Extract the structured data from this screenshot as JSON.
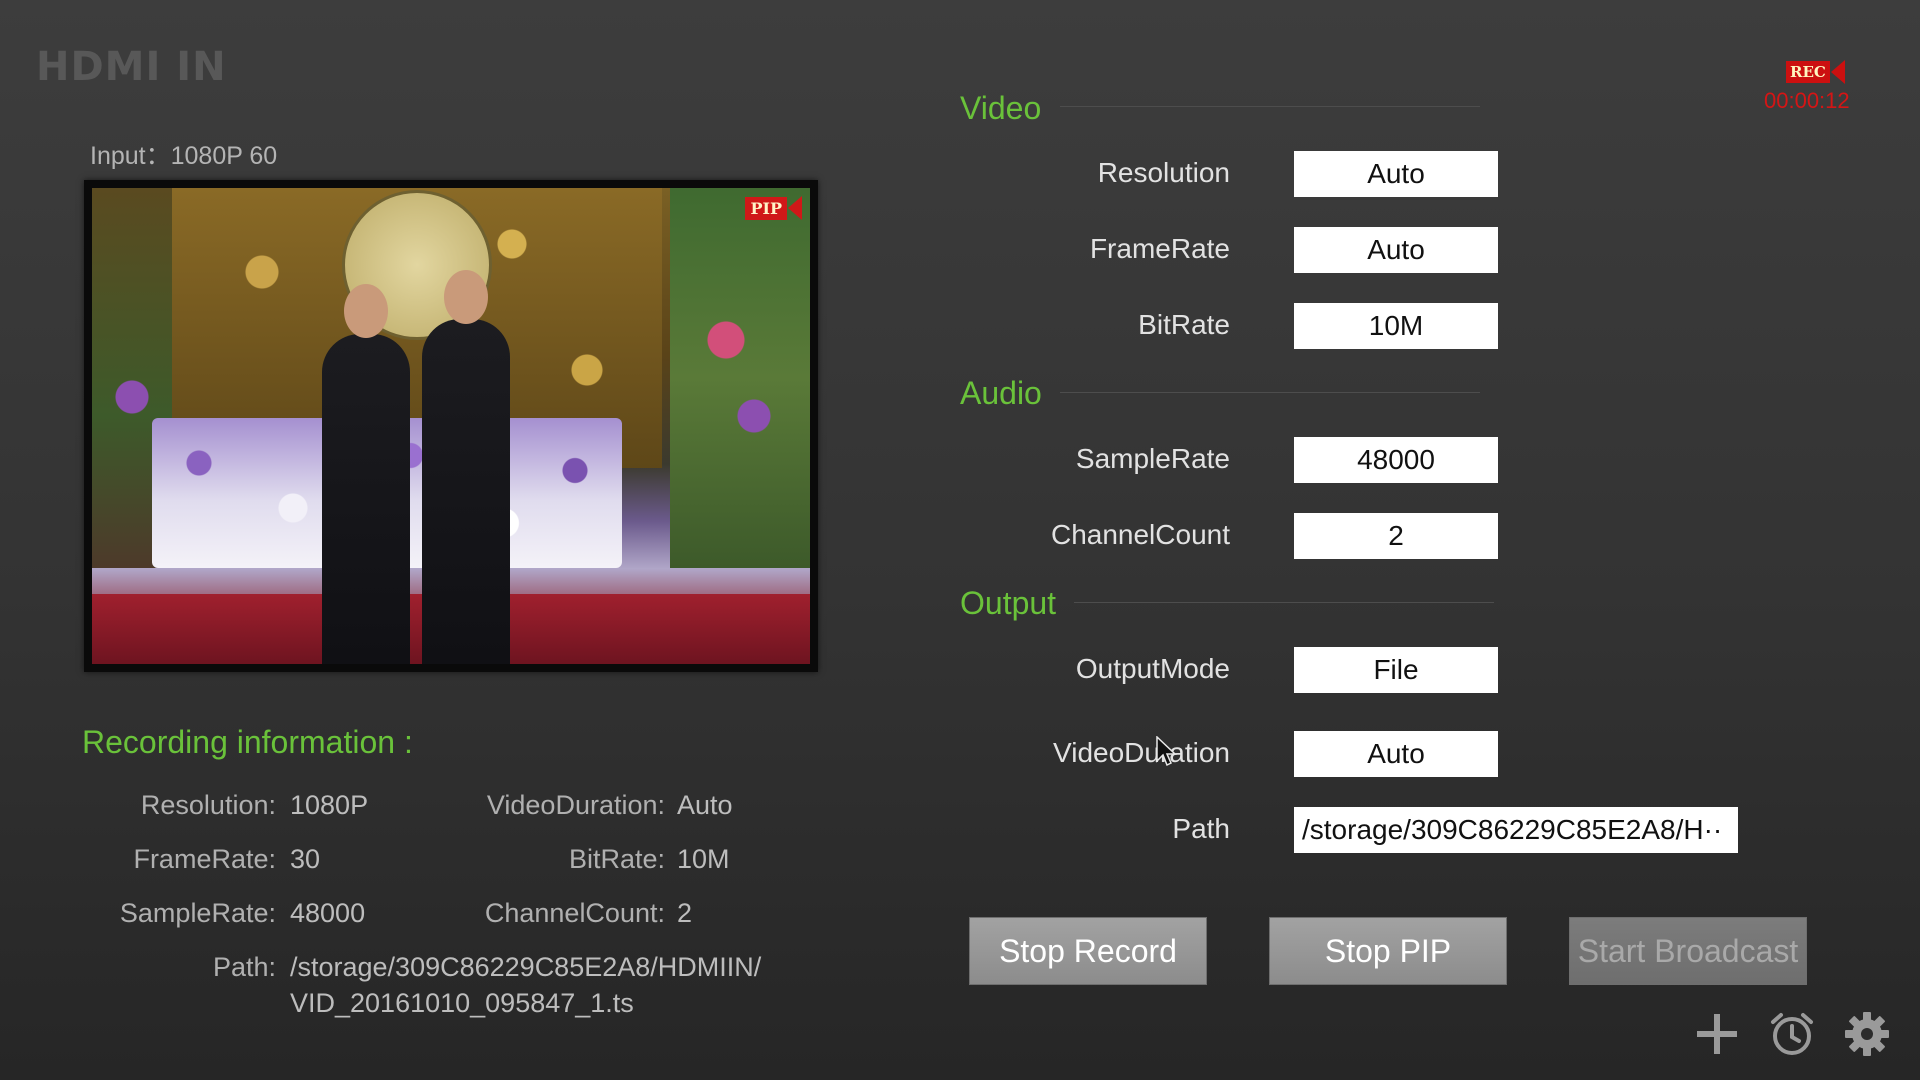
{
  "app": {
    "title": "HDMI IN"
  },
  "input": {
    "label": "Input：1080P 60"
  },
  "preview": {
    "pip_badge": "PIP"
  },
  "recording_indicator": {
    "badge": "REC",
    "elapsed": "00:00:12",
    "color": "#d51515"
  },
  "settings": {
    "video": {
      "title": "Video",
      "resolution": {
        "label": "Resolution",
        "value": "Auto"
      },
      "framerate": {
        "label": "FrameRate",
        "value": "Auto"
      },
      "bitrate": {
        "label": "BitRate",
        "value": "10M"
      }
    },
    "audio": {
      "title": "Audio",
      "samplerate": {
        "label": "SampleRate",
        "value": "48000"
      },
      "channelcount": {
        "label": "ChannelCount",
        "value": "2"
      }
    },
    "output": {
      "title": "Output",
      "outputmode": {
        "label": "OutputMode",
        "value": "File"
      },
      "videoduration": {
        "label": "VideoDuration",
        "value": "Auto"
      },
      "path": {
        "label": "Path",
        "value": "/storage/309C86229C85E2A8/H··"
      }
    }
  },
  "recording_info": {
    "title": "Recording information :",
    "resolution": {
      "label": "Resolution:",
      "value": "1080P"
    },
    "videoduration": {
      "label": "VideoDuration:",
      "value": "Auto"
    },
    "framerate": {
      "label": "FrameRate:",
      "value": "30"
    },
    "bitrate": {
      "label": "BitRate:",
      "value": "10M"
    },
    "samplerate": {
      "label": "SampleRate:",
      "value": "48000"
    },
    "channelcount": {
      "label": "ChannelCount:",
      "value": "2"
    },
    "path": {
      "label": "Path:",
      "line1": "/storage/309C86229C85E2A8/HDMIIN/",
      "line2": "VID_20161010_095847_1.ts"
    }
  },
  "buttons": {
    "stop_record": "Stop Record",
    "stop_pip": "Stop PIP",
    "start_broadcast": "Start Broadcast"
  },
  "toolbar": {
    "icons": [
      "add-icon",
      "alarm-clock-icon",
      "gear-icon"
    ]
  },
  "colors": {
    "accent": "#6ac23a",
    "background": "#383838",
    "rec_red": "#cc1010"
  }
}
